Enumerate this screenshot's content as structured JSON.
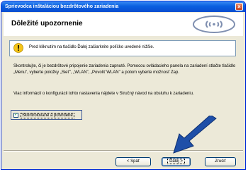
{
  "window": {
    "title": "Sprievodca inštaláciou bezdrôtového zariadenia",
    "close_symbol": "×"
  },
  "header": {
    "title": "Dôležité upozornenie",
    "logo_icon": "wireless-logo-icon"
  },
  "warning": {
    "icon": "warning-icon",
    "text": "Pred kliknutím na tlačidlo Ďalej začiarknite políčko uvedené nižšie."
  },
  "body": {
    "paragraph1": "Skontrolujte, či je bezdrôtové pripojenie zariadenia zapnuté. Pomocou ovládacieho panela na zariadení stlačte tlačidlo „Menu\", vyberte položky „Sieť\", „WLAN\", „Povoliť WLAN\" a potom vyberte možnosť Zap.",
    "paragraph2": "Viac informácií o konfigurácii tohto nastavenia nájdete v Stručný návod na obsluhu k zariadeniu."
  },
  "checkbox": {
    "label": "Skontrolované a potvrdené",
    "checked": true
  },
  "buttons": {
    "back": "< Späť",
    "next": "Ďalej >",
    "cancel": "Zrušiť"
  },
  "colors": {
    "titlebar": "#0a5fe0",
    "dialog_bg": "#ece9d8",
    "arrow": "#1e4fa8"
  }
}
